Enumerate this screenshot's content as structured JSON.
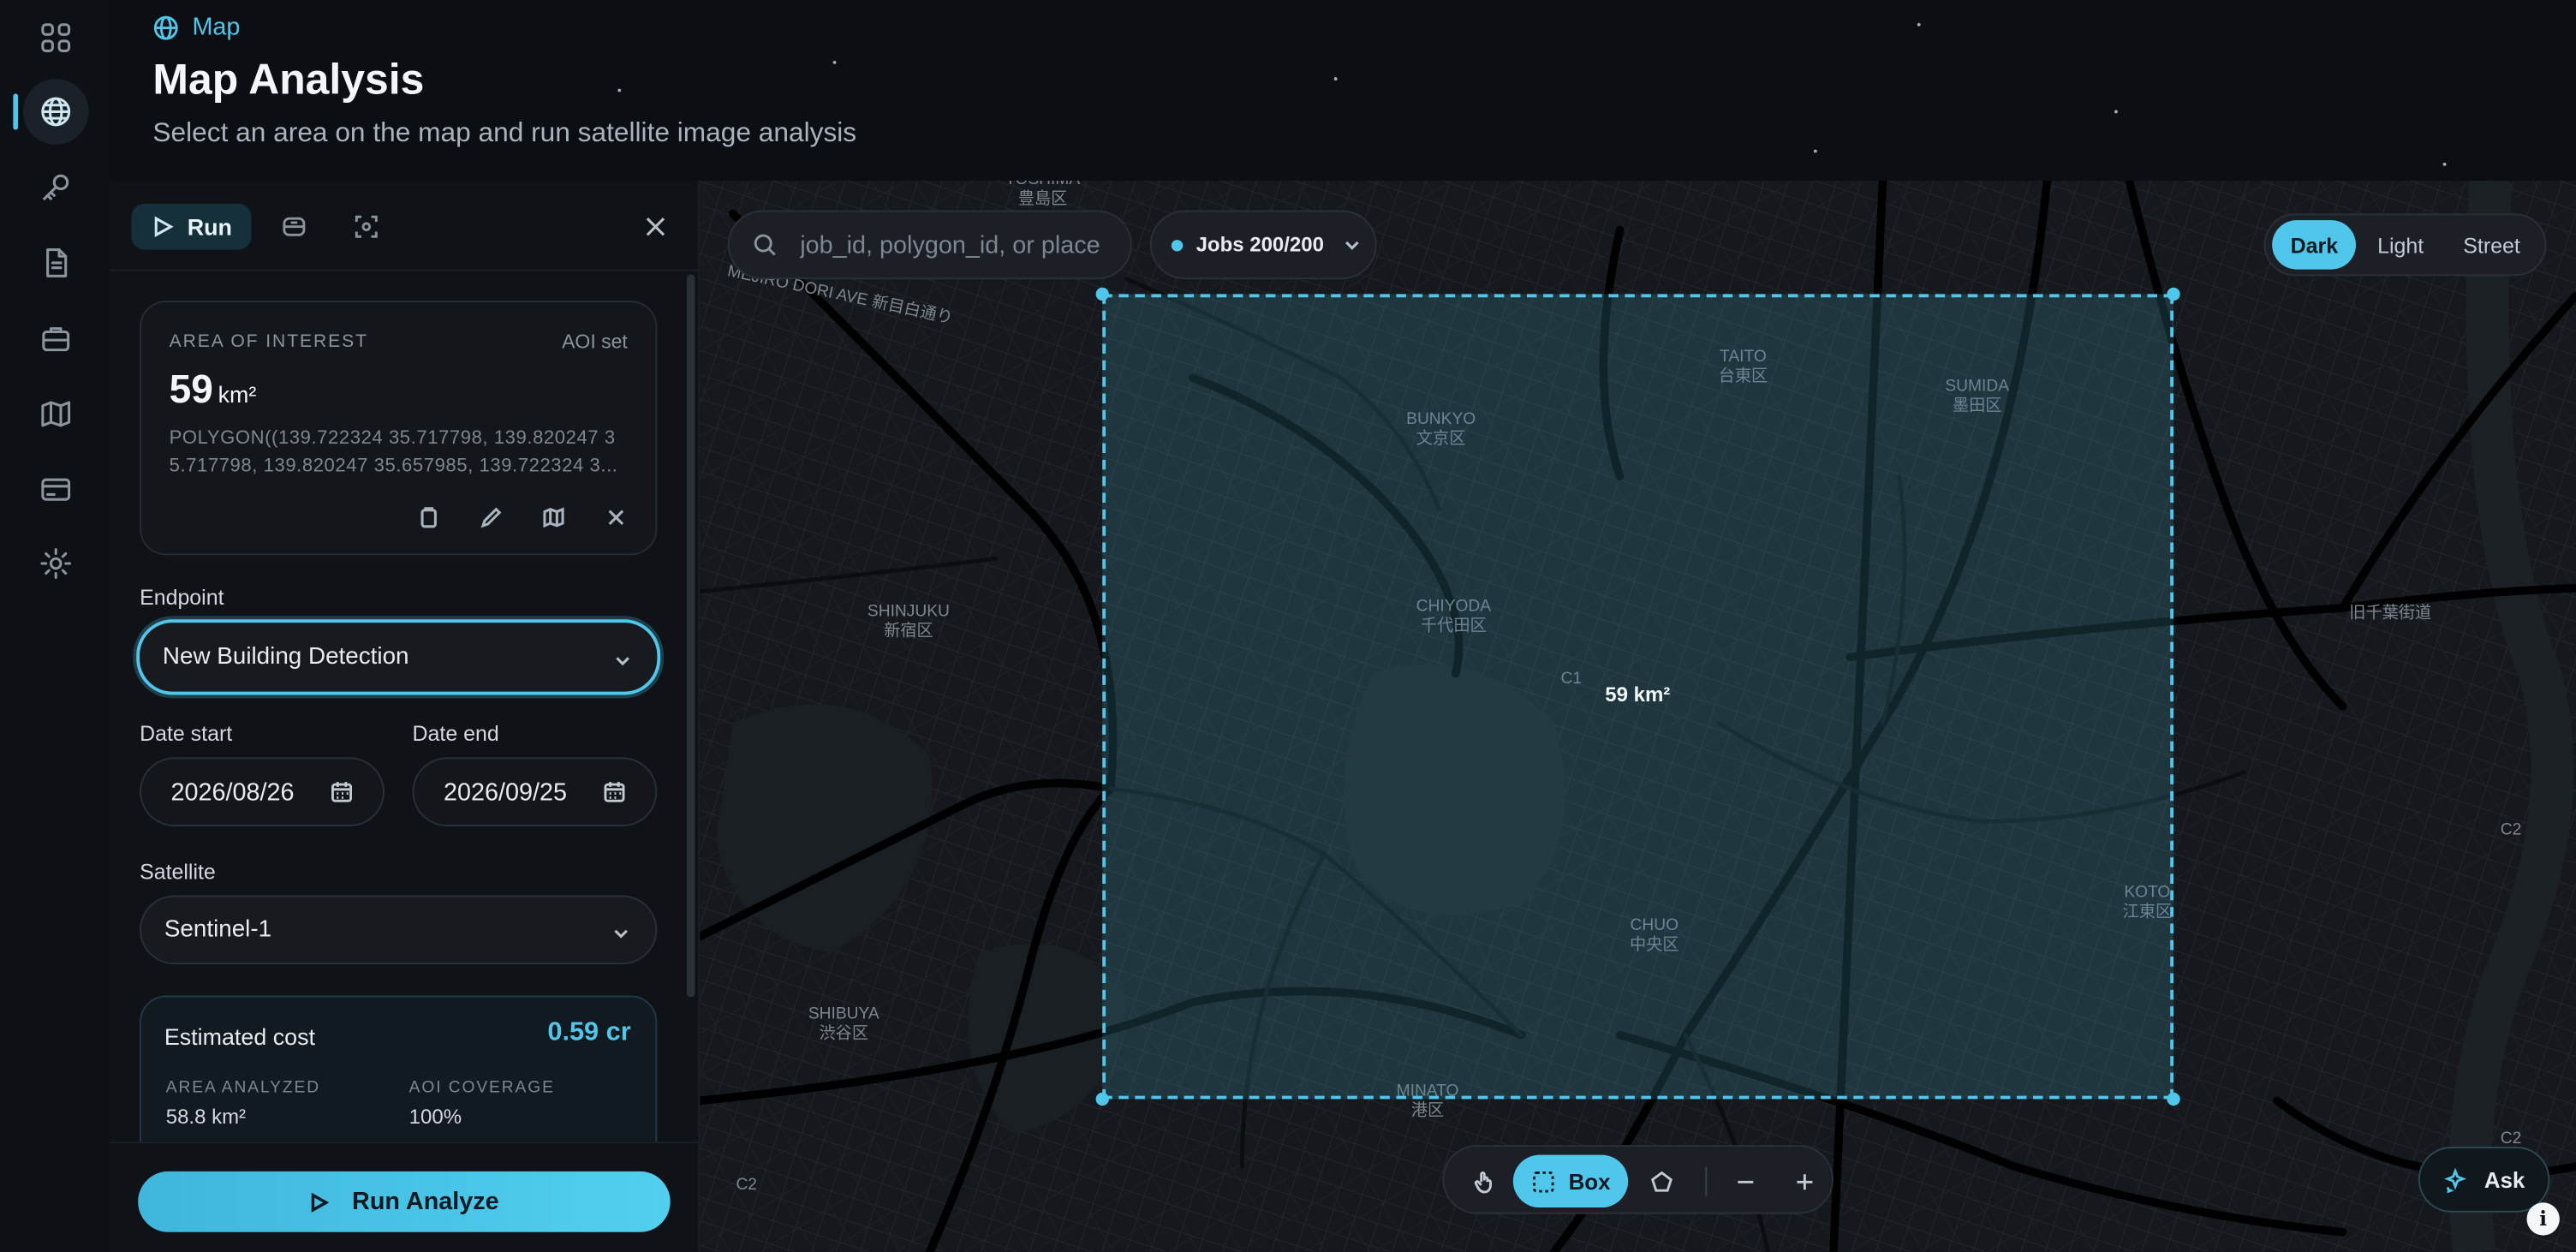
{
  "breadcrumb": {
    "icon": "globe-icon",
    "label": "Map"
  },
  "page": {
    "title": "Map Analysis",
    "subtitle": "Select an area on the map and run satellite image analysis"
  },
  "rail": {
    "items": [
      {
        "icon": "grid-icon"
      },
      {
        "icon": "globe-icon",
        "active": true
      },
      {
        "icon": "key-icon"
      },
      {
        "icon": "document-icon"
      },
      {
        "icon": "briefcase-icon"
      },
      {
        "icon": "map-icon"
      },
      {
        "icon": "credit-card-icon"
      },
      {
        "icon": "gear-icon"
      }
    ]
  },
  "panel": {
    "tabs": {
      "run_label": "Run"
    },
    "aoi": {
      "label": "AREA OF INTEREST",
      "status": "AOI set",
      "value": "59",
      "unit": "km²",
      "polygon": "POLYGON((139.722324 35.717798, 139.820247 35.717798, 139.820247 35.657985, 139.722324 3..."
    },
    "endpoint": {
      "label": "Endpoint",
      "value": "New Building Detection"
    },
    "date_start": {
      "label": "Date start",
      "value": "2026/08/26"
    },
    "date_end": {
      "label": "Date end",
      "value": "2026/09/25"
    },
    "satellite": {
      "label": "Satellite",
      "value": "Sentinel-1"
    },
    "cost": {
      "label": "Estimated cost",
      "value": "0.59 cr",
      "area_key": "AREA ANALYZED",
      "area_value": "58.8 km²",
      "coverage_key": "AOI COVERAGE",
      "coverage_value": "100%"
    },
    "run_button": "Run Analyze"
  },
  "map": {
    "search_placeholder": "job_id, polygon_id, or place",
    "jobs_label": "Jobs 200/200",
    "styles": [
      "Dark",
      "Light",
      "Street"
    ],
    "active_style": "Dark",
    "area_label": "59 km²",
    "tools": {
      "box_label": "Box"
    },
    "ask_label": "Ask",
    "info_label": "i",
    "labels": {
      "toshima": "TOSHIMA\n豊島区",
      "bunkyo": "BUNKYO\n文京区",
      "taito": "TAITO\n台東区",
      "sumida": "SUMIDA\n墨田区",
      "shinjuku": "SHINJUKU\n新宿区",
      "chiyoda": "CHIYODA\n千代田区",
      "chuo": "CHUO\n中央区",
      "koto": "KOTO\n江東区",
      "shibuya": "SHIBUYA\n渋谷区",
      "minato": "MINATO\n港区",
      "meiji": "MEJIRO DORI AVE 新目白通り",
      "kyuchiba": "旧千葉街道",
      "c1": "C1",
      "c2a": "C2",
      "c2b": "C2",
      "c2c": "C2"
    }
  },
  "colors": {
    "accent": "#4fc6ea",
    "background": "#0b0e12",
    "panel": "#0f1216"
  }
}
